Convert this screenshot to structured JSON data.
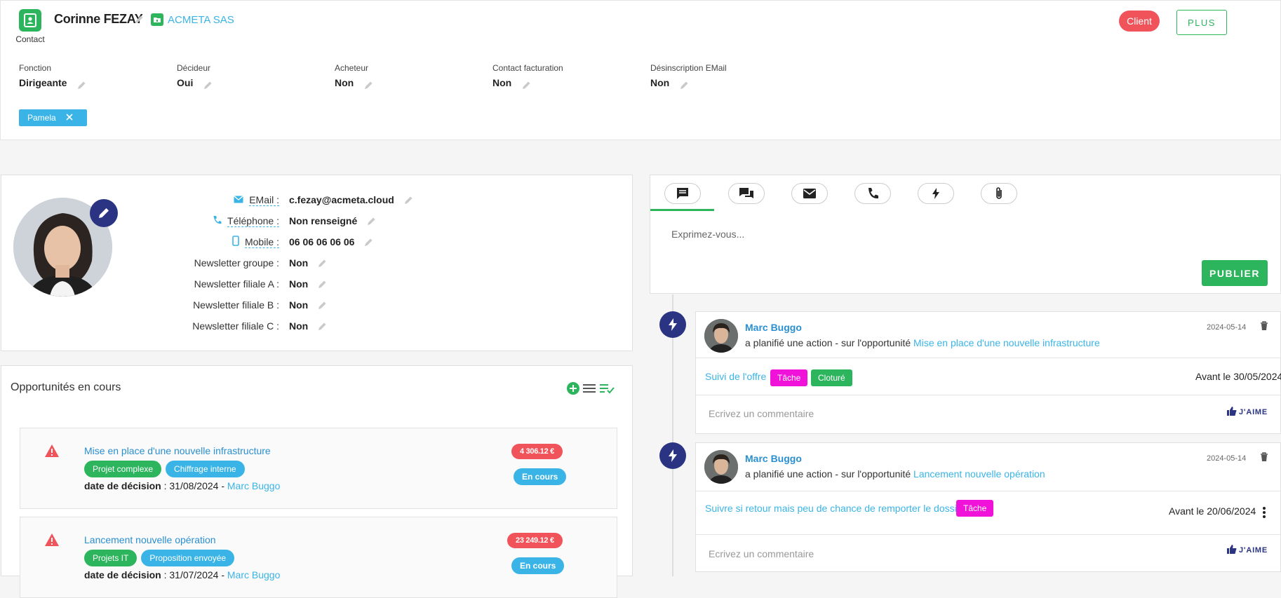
{
  "header": {
    "contact_label": "Contact",
    "name": "Corinne FEZAY",
    "company": "ACMETA SAS",
    "client_badge": "Client",
    "plus_button": "PLUS",
    "fields": [
      {
        "label": "Fonction",
        "value": "Dirigeante"
      },
      {
        "label": "Décideur",
        "value": "Oui"
      },
      {
        "label": "Acheteur",
        "value": "Non"
      },
      {
        "label": "Contact facturation",
        "value": "Non"
      },
      {
        "label": "Désinscription EMail",
        "value": "Non"
      }
    ],
    "tag": "Pamela"
  },
  "profile": {
    "rows": [
      {
        "label": "EMail :",
        "value": "c.fezay@acmeta.cloud",
        "icon": "mail-icon"
      },
      {
        "label": "Téléphone :",
        "value": "Non renseigné",
        "icon": "phone-icon"
      },
      {
        "label": "Mobile :",
        "value": "06 06 06 06 06",
        "icon": "mobile-icon"
      },
      {
        "label": "Newsletter groupe :",
        "value": "Non"
      },
      {
        "label": "Newsletter filiale A :",
        "value": "Non"
      },
      {
        "label": "Newsletter filiale B :",
        "value": "Non"
      },
      {
        "label": "Newsletter filiale C :",
        "value": "Non"
      }
    ]
  },
  "opportunities": {
    "title": "Opportunités en cours",
    "items": [
      {
        "title": "Mise en place d'une nouvelle infrastructure",
        "tags": [
          "Projet complexe",
          "Chiffrage interne"
        ],
        "decision_label": "date de décision",
        "decision_date": " : 31/08/2024 - ",
        "owner": "Marc Buggo",
        "amount": "4 306.12 €",
        "status": "En cours"
      },
      {
        "title": "Lancement nouvelle opération",
        "tags": [
          "Projets IT",
          "Proposition envoyée"
        ],
        "decision_label": "date de décision",
        "decision_date": " : 31/07/2024 - ",
        "owner": "Marc Buggo",
        "amount": "23 249.12 €",
        "status": "En cours"
      }
    ]
  },
  "composer": {
    "placeholder": "Exprimez-vous...",
    "publish": "PUBLIER",
    "tabs": [
      "comment-icon",
      "chat-icon",
      "envelope-icon",
      "phone-icon",
      "lightning-icon",
      "paperclip-icon"
    ]
  },
  "timeline": [
    {
      "author": "Marc Buggo",
      "action": "a planifié une action - sur l'opportunité ",
      "link": "Mise en place d'une nouvelle infrastructure",
      "date": "2024-05-14",
      "task": "Suivi de l'offre",
      "badges": [
        "Tâche",
        "Cloturé"
      ],
      "deadline": "Avant le 30/05/2024",
      "comment_placeholder": "Ecrivez un commentaire",
      "like": "J'AIME"
    },
    {
      "author": "Marc Buggo",
      "action": "a planifié une action - sur l'opportunité ",
      "link": "Lancement nouvelle opération",
      "date": "2024-05-14",
      "task": "Suivre si retour mais peu de chance de remporter le dossier",
      "badges": [
        "Tâche"
      ],
      "deadline": "Avant le 20/06/2024",
      "comment_placeholder": "Ecrivez un commentaire",
      "like": "J'AIME"
    }
  ]
}
